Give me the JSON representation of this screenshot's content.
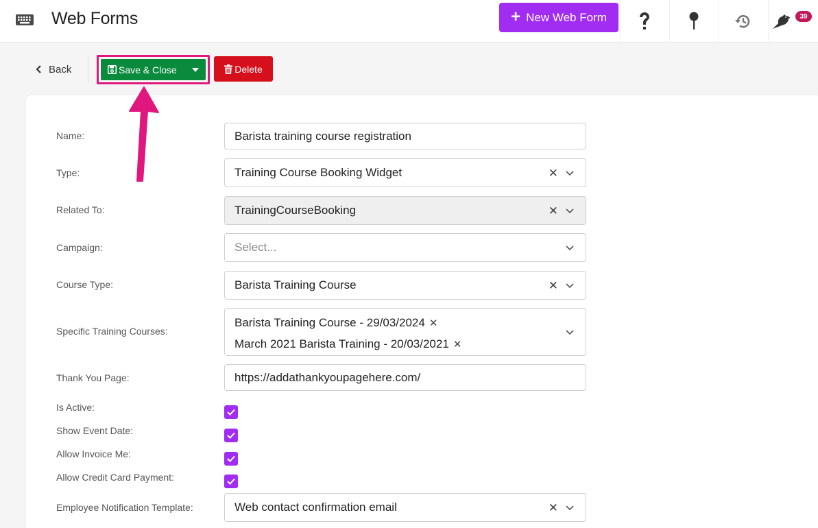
{
  "header": {
    "title": "Web Forms",
    "new_button_label": "New Web Form",
    "notification_count": "39"
  },
  "actions": {
    "back_label": "Back",
    "save_label": "Save & Close",
    "delete_label": "Delete"
  },
  "form": {
    "name": {
      "label": "Name:",
      "value": "Barista training course registration"
    },
    "type": {
      "label": "Type:",
      "value": "Training Course Booking Widget"
    },
    "related_to": {
      "label": "Related To:",
      "value": "TrainingCourseBooking"
    },
    "campaign": {
      "label": "Campaign:",
      "placeholder": "Select..."
    },
    "course_type": {
      "label": "Course Type:",
      "value": "Barista Training Course"
    },
    "specific_courses": {
      "label": "Specific Training Courses:",
      "tags": [
        "Barista Training Course - 29/03/2024",
        "March 2021 Barista Training - 20/03/2021"
      ]
    },
    "thank_you_page": {
      "label": "Thank You Page:",
      "value": "https://addathankyoupagehere.com/"
    },
    "is_active": {
      "label": "Is Active:",
      "checked": true
    },
    "show_event_date": {
      "label": "Show Event Date:",
      "checked": true
    },
    "allow_invoice_me": {
      "label": "Allow Invoice Me:",
      "checked": true
    },
    "allow_credit_card": {
      "label": "Allow Credit Card Payment:",
      "checked": true
    },
    "employee_notification_template": {
      "label": "Employee Notification Template:",
      "value": "Web contact confirmation email"
    }
  },
  "colors": {
    "accent": "#a12cf2",
    "save_green": "#0a8a3c",
    "delete_red": "#d50f1b",
    "annotation_pink": "#e0177f",
    "badge": "#c2185b"
  },
  "icons": [
    "keyboard-icon",
    "plus-icon",
    "help-icon",
    "pin-icon",
    "history-icon",
    "bird-icon",
    "chevron-left-icon",
    "save-icon",
    "caret-down-icon",
    "trash-icon",
    "clear-icon",
    "chevron-down-icon",
    "check-icon",
    "annotation-arrow"
  ]
}
